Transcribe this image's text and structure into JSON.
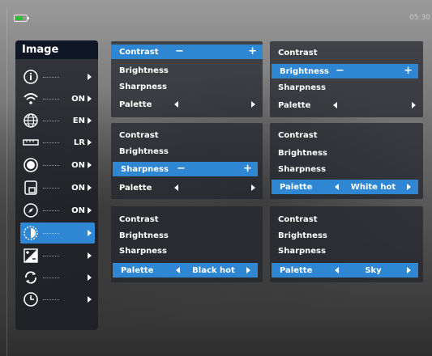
{
  "status": {
    "battery_pct": "",
    "clock": "05:30",
    "battery_color": "#2fbf3a"
  },
  "sidebar": {
    "title": "Image",
    "items": [
      {
        "icon": "info-icon",
        "value": ""
      },
      {
        "icon": "wifi-icon",
        "value": "ON"
      },
      {
        "icon": "globe-icon",
        "value": "EN"
      },
      {
        "icon": "ruler-icon",
        "value": "LR"
      },
      {
        "icon": "record-icon",
        "value": "ON"
      },
      {
        "icon": "picture-in-picture-icon",
        "value": "ON"
      },
      {
        "icon": "compass-icon",
        "value": "ON"
      },
      {
        "icon": "image-mode-icon",
        "value": ""
      },
      {
        "icon": "exposure-icon",
        "value": ""
      },
      {
        "icon": "refresh-icon",
        "value": ""
      },
      {
        "icon": "clock-icon",
        "value": ""
      }
    ]
  },
  "labels": {
    "contrast": "Contrast",
    "brightness": "Brightness",
    "sharpness": "Sharpness",
    "palette": "Palette"
  },
  "symbols": {
    "minus": "−",
    "plus": "+"
  },
  "panels": {
    "p3_palette_value": "White hot",
    "p5_palette_value": "Black hot",
    "p6_palette_value": "Sky"
  },
  "colors": {
    "accent": "#2f86d2",
    "sidebar_title_bg": "#0f1626"
  }
}
